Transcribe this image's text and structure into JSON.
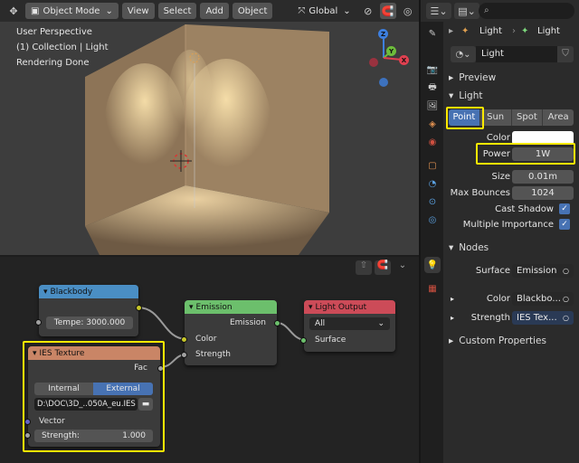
{
  "viewport_header": {
    "mode": "Object Mode",
    "menus": [
      "View",
      "Select",
      "Add",
      "Object"
    ],
    "orientation": "Global"
  },
  "viewport_overlay": {
    "perspective": "User Perspective",
    "collection": "(1) Collection | Light",
    "status": "Rendering Done"
  },
  "gizmo": {
    "z": "Z",
    "y": "Y",
    "x": "X"
  },
  "nodes": {
    "blackbody": {
      "title": "Blackbody",
      "field_label": "Tempe:",
      "field_value": "3000.000"
    },
    "emission": {
      "title": "Emission",
      "output": "Emission",
      "input_color": "Color",
      "input_strength": "Strength"
    },
    "light_output": {
      "title": "Light Output",
      "target": "All",
      "input_surface": "Surface"
    },
    "ies": {
      "title": "IES Texture",
      "output": "Fac",
      "tab_internal": "Internal",
      "tab_external": "External",
      "filepath": "D:\\DOC\\3D_..050A_eu.IES",
      "input_vector": "Vector",
      "strength_label": "Strength:",
      "strength_value": "1.000"
    }
  },
  "properties": {
    "breadcrumb_object": "Light",
    "breadcrumb_data": "Light",
    "datablock_name": "Light",
    "preview_label": "Preview",
    "light_label": "Light",
    "light_types": [
      "Point",
      "Sun",
      "Spot",
      "Area"
    ],
    "active_type": "Point",
    "color_label": "Color",
    "power_label": "Power",
    "power_value": "1W",
    "size_label": "Size",
    "size_value": "0.01m",
    "bounces_label": "Max Bounces",
    "bounces_value": "1024",
    "cast_shadow": "Cast Shadow",
    "multiple_importance": "Multiple Importance",
    "nodes_label": "Nodes",
    "surface_label": "Surface",
    "surface_value": "Emission",
    "color_link_label": "Color",
    "color_link_value": "Blackbo...",
    "strength_label": "Strength",
    "strength_value": "IES Tex...",
    "custom_props": "Custom Properties"
  },
  "colors": {
    "accent": "#4772b3",
    "highlight": "#ffea00",
    "blackbody_header": "#4a8ec4",
    "emission_header": "#6cbf6c",
    "output_header": "#cc4b58",
    "ies_header": "#c98566"
  }
}
